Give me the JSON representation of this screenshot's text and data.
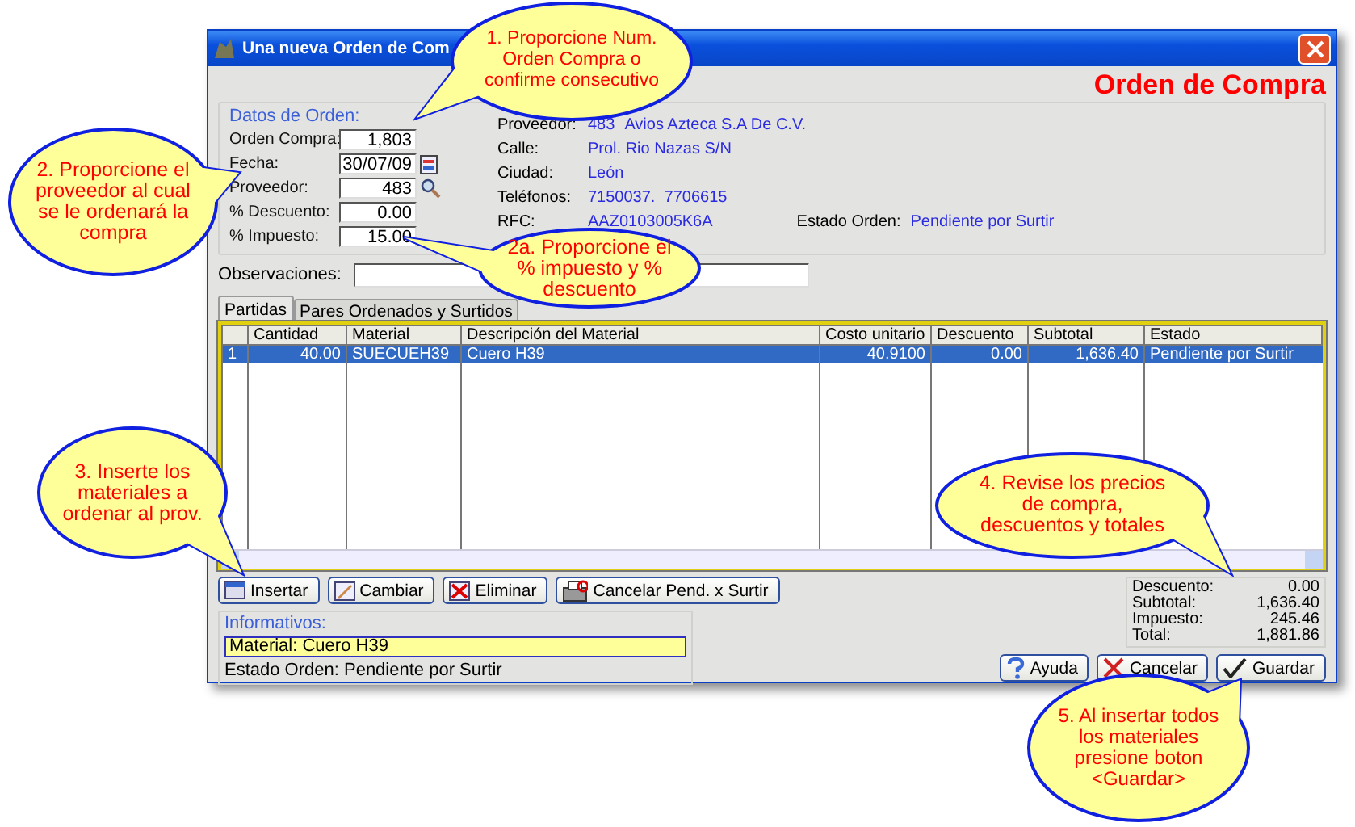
{
  "window": {
    "title": "Una nueva Orden de Com",
    "heading": "Orden de Compra"
  },
  "order_data": {
    "legend": "Datos de Orden:",
    "fields": [
      {
        "label": "Orden Compra:",
        "value": "1,803",
        "kind": "plain"
      },
      {
        "label": "Fecha:",
        "value": "30/07/09",
        "kind": "date"
      },
      {
        "label": "Proveedor:",
        "value": "483",
        "kind": "lookup"
      },
      {
        "label": "% Descuento:",
        "value": "0.00",
        "kind": "plain"
      },
      {
        "label": "% Impuesto:",
        "value": "15.00",
        "kind": "plain"
      }
    ],
    "supplier": [
      {
        "label": "Proveedor:",
        "values": [
          "483",
          "Avios Azteca S.A De C.V."
        ]
      },
      {
        "label": "Calle:",
        "values": [
          "Prol. Rio Nazas S/N"
        ]
      },
      {
        "label": "Ciudad:",
        "values": [
          "León"
        ]
      },
      {
        "label": "Teléfonos:",
        "values": [
          "7150037.  7706615"
        ]
      },
      {
        "label": "RFC:",
        "values": [
          "AAZ0103005K6A"
        ]
      }
    ],
    "status": {
      "label": "Estado Orden:",
      "value": "Pendiente por Surtir"
    }
  },
  "observations": {
    "label": "Observaciones:"
  },
  "tabs": [
    {
      "label": "Partidas",
      "selected": true
    },
    {
      "label": "Pares Ordenados y Surtidos",
      "selected": false
    }
  ],
  "table": {
    "columns": [
      "Cantidad",
      "Material",
      "Descripción del Material",
      "Costo unitario",
      "Descuento",
      "Subtotal",
      "Estado"
    ],
    "rows": [
      {
        "number": "1",
        "cells": [
          "40.00",
          "SUECUEH39",
          "Cuero H39",
          "40.9100",
          "0.00",
          "1,636.40",
          "Pendiente por Surtir"
        ],
        "selected": true
      }
    ]
  },
  "row_buttons": [
    {
      "label": "Insertar"
    },
    {
      "label": "Cambiar"
    },
    {
      "label": "Eliminar"
    },
    {
      "label": "Cancelar Pend. x Surtir"
    }
  ],
  "info": {
    "legend": "Informativos:",
    "material": "Material: Cuero H39",
    "status": "Estado Orden: Pendiente por Surtir"
  },
  "totals": [
    {
      "label": "Descuento:",
      "value": "0.00"
    },
    {
      "label": "Subtotal:",
      "value": "1,636.40"
    },
    {
      "label": "Impuesto:",
      "value": "245.46"
    },
    {
      "label": "Total:",
      "value": "1,881.86"
    }
  ],
  "actions": [
    {
      "label": "Ayuda"
    },
    {
      "label": "Cancelar"
    },
    {
      "label": "Guardar"
    }
  ],
  "callouts": [
    {
      "text": "1. Proporcione Num. Orden Compra o confirme consecutivo"
    },
    {
      "text": "2. Proporcione el proveedor al cual se le ordenará la compra"
    },
    {
      "text": "2a. Proporcione el % impuesto y % descuento"
    },
    {
      "text": "3. Inserte los materiales a ordenar al prov."
    },
    {
      "text": "4. Revise los precios de compra, descuentos y totales"
    },
    {
      "text": "5. Al insertar todos los materiales presione boton <Guardar>"
    }
  ]
}
